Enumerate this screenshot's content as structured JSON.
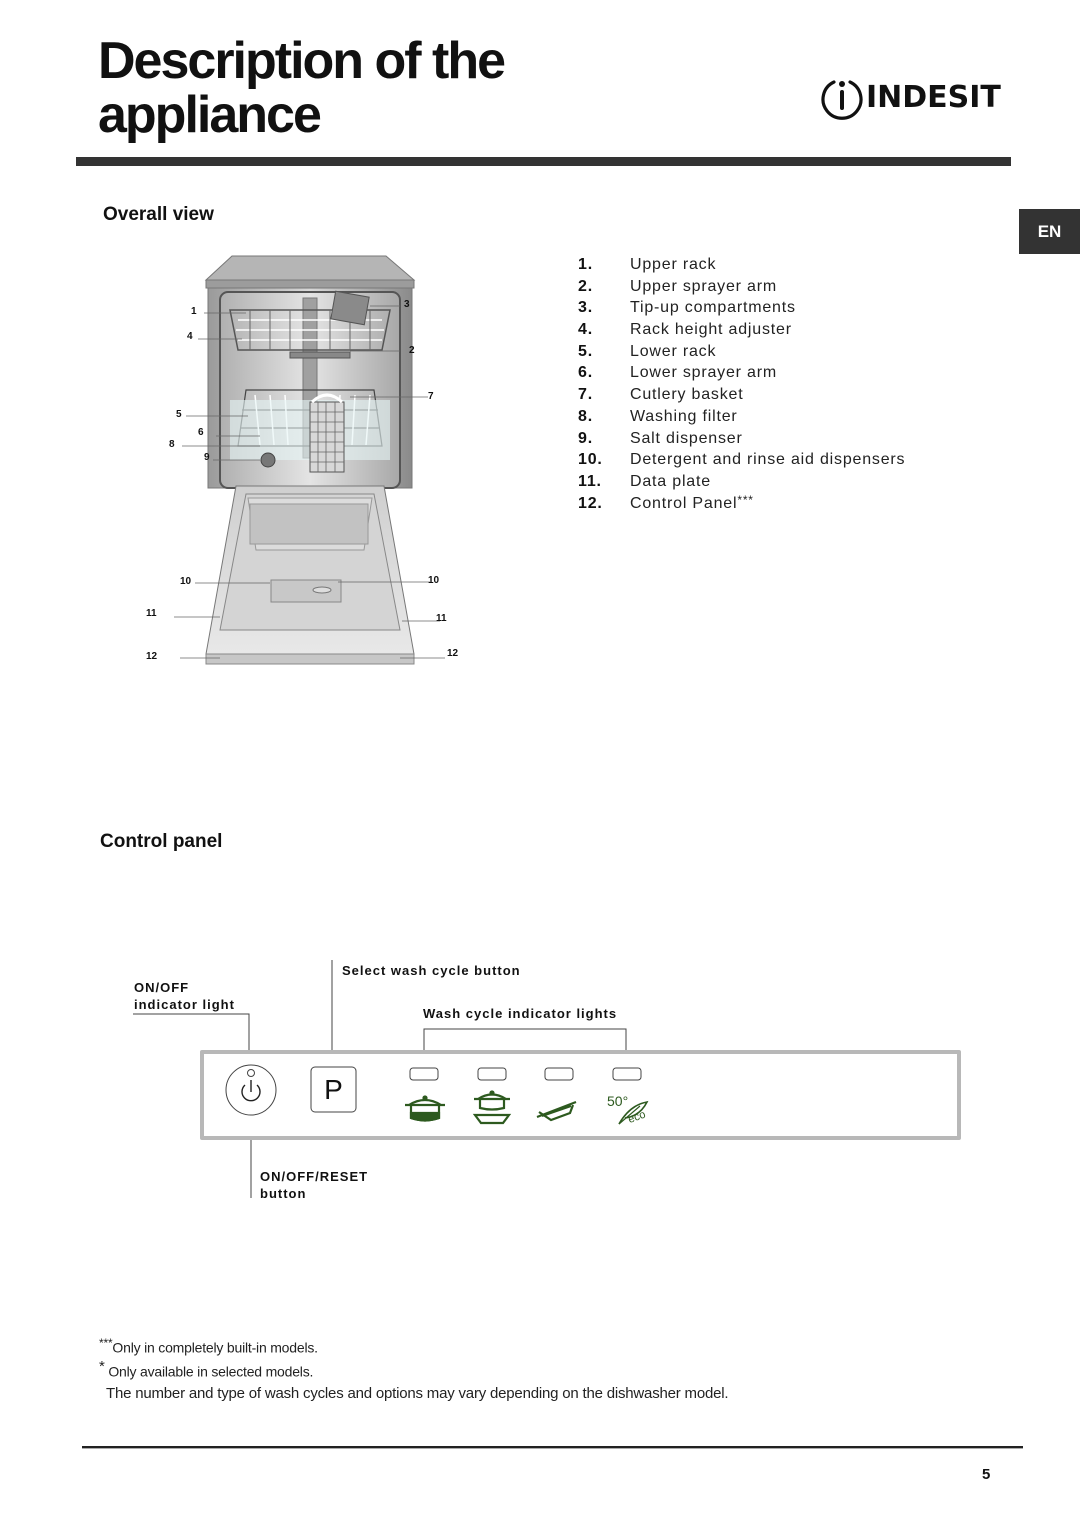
{
  "header": {
    "title_line1": "Description of the",
    "title_line2": "appliance",
    "brand": "INDESIT",
    "language_tab": "EN"
  },
  "overall_view": {
    "heading": "Overall view",
    "callout_labels": [
      "1",
      "2",
      "3",
      "4",
      "5",
      "6",
      "7",
      "8",
      "9",
      "10",
      "10",
      "11",
      "11",
      "12",
      "12"
    ],
    "legend": [
      {
        "num": "1.",
        "label": "Upper rack"
      },
      {
        "num": "2.",
        "label": "Upper sprayer arm"
      },
      {
        "num": "3.",
        "label": "Tip-up compartments"
      },
      {
        "num": "4.",
        "label": "Rack height adjuster"
      },
      {
        "num": "5.",
        "label": "Lower rack"
      },
      {
        "num": "6.",
        "label": "Lower sprayer arm"
      },
      {
        "num": "7.",
        "label": "Cutlery basket"
      },
      {
        "num": "8.",
        "label": "Washing filter"
      },
      {
        "num": "9.",
        "label": "Salt dispenser"
      },
      {
        "num": "10.",
        "label": "Detergent and rinse aid dispensers"
      },
      {
        "num": "11.",
        "label": "Data plate"
      },
      {
        "num": "12.",
        "label": "Control Panel",
        "sup": "***"
      }
    ]
  },
  "control_panel": {
    "heading": "Control panel",
    "labels": {
      "onoff_light_1": "ON/OFF",
      "onoff_light_2": "indicator light",
      "select_button": "Select wash cycle button",
      "indicator_lights": "Wash cycle indicator lights",
      "reset_1": "ON/OFF/RESET",
      "reset_2": "button"
    },
    "program_button_label": "P",
    "eco_temp": "50°",
    "eco_text": "eco",
    "icon_color": "#2d5a1f",
    "cycles": [
      "intensive-pot-icon",
      "normal-pot-plate-icon",
      "quick-plate-icon",
      "eco-leaf-icon"
    ]
  },
  "footnotes": {
    "note1_mark": "***",
    "note1": "Only in completely built-in models.",
    "note2_mark": "*",
    "note2": " Only available in selected models.",
    "note3": "The number and type of wash cycles and options may vary depending on the dishwasher model."
  },
  "page_number": "5"
}
